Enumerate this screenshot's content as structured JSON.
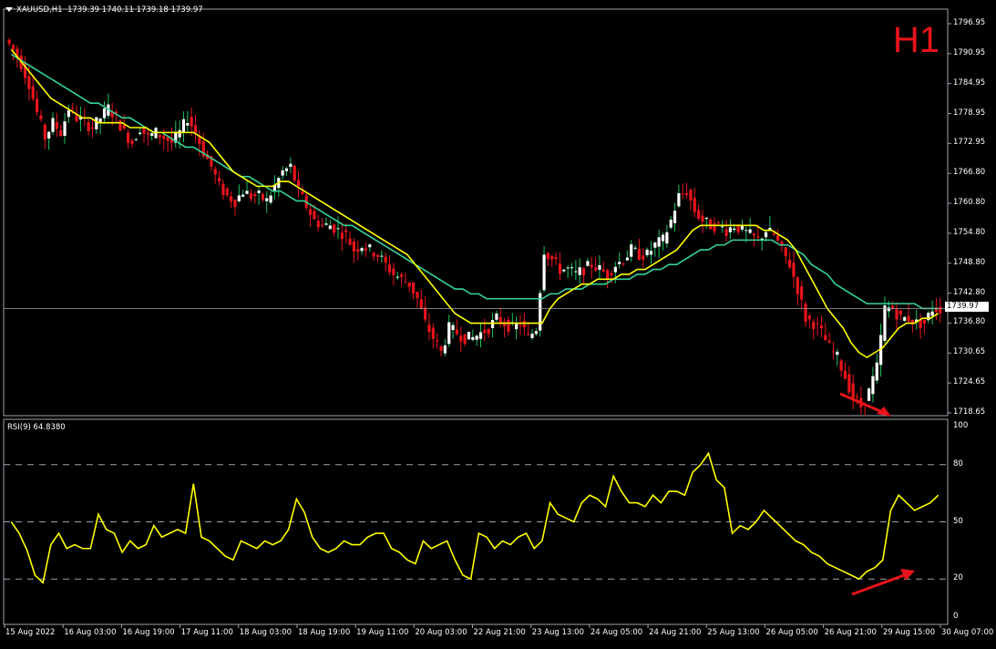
{
  "header": {
    "symbol": "XAUUSD,H1",
    "ohlc": "1739.39 1740.11 1739.18 1739.97"
  },
  "timeframe_label": "H1",
  "current_price": "1739.97",
  "rsi_header": "RSI(9) 64.8380",
  "colors": {
    "bull": "#ffffff",
    "bear": "#e8141a",
    "bullish_wick_green": "#22c55e",
    "ma_fast": "#ffff00",
    "ma_slow": "#34d399",
    "rsi": "#ffff00",
    "arrow": "#e8141a"
  },
  "chart_data": {
    "type": "candlestick",
    "symbol": "XAUUSD",
    "period": "H1",
    "price_axis": {
      "ylim": [
        1718.65,
        1796.95
      ],
      "ticks": [
        "1796.95",
        "1790.95",
        "1784.95",
        "1778.95",
        "1772.95",
        "1766.80",
        "1760.80",
        "1754.80",
        "1748.80",
        "1742.80",
        "1736.80",
        "1730.65",
        "1724.65",
        "1718.65"
      ]
    },
    "time_axis": {
      "ticks": [
        "15 Aug 2022",
        "16 Aug 03:00",
        "16 Aug 19:00",
        "17 Aug 11:00",
        "18 Aug 03:00",
        "18 Aug 19:00",
        "19 Aug 11:00",
        "20 Aug 03:00",
        "22 Aug 21:00",
        "23 Aug 13:00",
        "24 Aug 05:00",
        "24 Aug 21:00",
        "25 Aug 13:00",
        "26 Aug 05:00",
        "26 Aug 21:00",
        "29 Aug 15:00",
        "30 Aug 07:00"
      ]
    },
    "price_path": [
      1795,
      1793,
      1790,
      1786,
      1780,
      1775,
      1778,
      1776,
      1781,
      1779,
      1778,
      1777,
      1779,
      1781,
      1779,
      1776,
      1774,
      1777,
      1775,
      1776,
      1775,
      1774,
      1776,
      1779,
      1776,
      1772,
      1769,
      1765,
      1763,
      1762,
      1764,
      1763,
      1763,
      1762,
      1765,
      1768,
      1769,
      1764,
      1761,
      1758,
      1757,
      1757,
      1756,
      1755,
      1752,
      1753,
      1752,
      1751,
      1749,
      1747,
      1746,
      1745,
      1742,
      1737,
      1734,
      1731,
      1736,
      1735,
      1734,
      1734,
      1735,
      1736,
      1738,
      1737,
      1736,
      1737,
      1734,
      1736,
      1752,
      1750,
      1748,
      1748,
      1747,
      1748,
      1749,
      1748,
      1747,
      1749,
      1750,
      1752,
      1751,
      1751,
      1753,
      1754,
      1758,
      1763,
      1764,
      1760,
      1758,
      1757,
      1757,
      1756,
      1757,
      1756,
      1755,
      1754,
      1756,
      1755,
      1752,
      1749,
      1744,
      1738,
      1737,
      1735,
      1732,
      1730,
      1726,
      1722,
      1720,
      1723,
      1728,
      1740,
      1740,
      1738,
      1738,
      1737,
      1737,
      1740
    ],
    "ma_fast": [
      1793,
      1791,
      1789,
      1787,
      1785,
      1783,
      1782,
      1781,
      1780,
      1779,
      1779,
      1778,
      1778,
      1778,
      1778,
      1777,
      1777,
      1777,
      1776,
      1776,
      1776,
      1776,
      1776,
      1776,
      1775,
      1774,
      1772,
      1770,
      1768,
      1767,
      1766,
      1765,
      1765,
      1765,
      1766,
      1766,
      1765,
      1764,
      1763,
      1762,
      1761,
      1760,
      1759,
      1758,
      1757,
      1756,
      1755,
      1754,
      1753,
      1752,
      1751,
      1749,
      1747,
      1745,
      1743,
      1741,
      1739,
      1738,
      1737,
      1737,
      1737,
      1737,
      1737,
      1737,
      1737,
      1737,
      1737,
      1737,
      1740,
      1742,
      1743,
      1744,
      1745,
      1745,
      1746,
      1746,
      1746,
      1747,
      1747,
      1748,
      1748,
      1749,
      1750,
      1751,
      1752,
      1754,
      1756,
      1757,
      1757,
      1757,
      1757,
      1757,
      1757,
      1757,
      1757,
      1756,
      1756,
      1755,
      1754,
      1752,
      1749,
      1746,
      1743,
      1740,
      1738,
      1736,
      1733,
      1731,
      1730,
      1731,
      1732,
      1734,
      1736,
      1737,
      1737,
      1738,
      1738,
      1739
    ],
    "ma_slow": [
      1792,
      1791,
      1790,
      1789,
      1788,
      1787,
      1786,
      1785,
      1784,
      1783,
      1782,
      1782,
      1781,
      1780,
      1779,
      1779,
      1778,
      1777,
      1776,
      1776,
      1775,
      1774,
      1773,
      1773,
      1772,
      1771,
      1770,
      1769,
      1768,
      1767,
      1767,
      1766,
      1765,
      1764,
      1764,
      1763,
      1762,
      1762,
      1761,
      1760,
      1759,
      1758,
      1757,
      1757,
      1756,
      1755,
      1754,
      1753,
      1752,
      1751,
      1750,
      1749,
      1748,
      1747,
      1746,
      1745,
      1744,
      1744,
      1743,
      1743,
      1742,
      1742,
      1742,
      1742,
      1742,
      1742,
      1742,
      1742,
      1743,
      1743,
      1744,
      1744,
      1744,
      1745,
      1745,
      1745,
      1746,
      1746,
      1746,
      1747,
      1747,
      1748,
      1748,
      1749,
      1749,
      1750,
      1751,
      1752,
      1752,
      1753,
      1753,
      1754,
      1754,
      1754,
      1754,
      1754,
      1754,
      1753,
      1753,
      1752,
      1751,
      1749,
      1748,
      1747,
      1745,
      1744,
      1743,
      1742,
      1741,
      1741,
      1741,
      1741,
      1741,
      1741,
      1741,
      1740,
      1740,
      1740
    ],
    "rsi": {
      "name": "RSI(9)",
      "last": 64.838,
      "ylim": [
        0,
        100
      ],
      "ticks": [
        "100",
        "80",
        "50",
        "20",
        "0"
      ],
      "levels": [
        80,
        50,
        20
      ],
      "values": [
        50,
        44,
        35,
        22,
        18,
        38,
        44,
        36,
        38,
        36,
        36,
        54,
        46,
        44,
        34,
        40,
        36,
        38,
        48,
        42,
        44,
        46,
        44,
        70,
        42,
        40,
        36,
        32,
        30,
        40,
        38,
        36,
        40,
        38,
        40,
        46,
        62,
        55,
        42,
        36,
        34,
        36,
        40,
        38,
        38,
        42,
        44,
        44,
        36,
        34,
        30,
        28,
        40,
        36,
        38,
        40,
        30,
        22,
        20,
        44,
        42,
        36,
        40,
        38,
        42,
        44,
        36,
        40,
        60,
        54,
        52,
        50,
        60,
        64,
        62,
        58,
        74,
        66,
        60,
        60,
        58,
        64,
        60,
        66,
        66,
        64,
        76,
        80,
        86,
        72,
        68,
        44,
        48,
        46,
        50,
        56,
        52,
        48,
        44,
        40,
        38,
        34,
        32,
        28,
        26,
        24,
        22,
        20,
        24,
        26,
        30,
        56,
        64,
        60,
        56,
        58,
        60,
        64
      ]
    }
  }
}
